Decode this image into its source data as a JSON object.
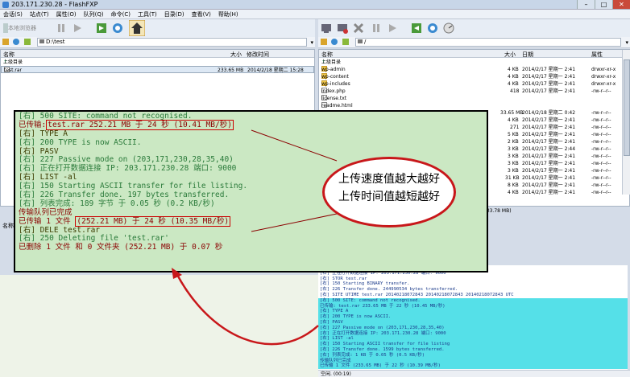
{
  "window": {
    "title": "203.171.230.28 - FlashFXP"
  },
  "menu": [
    "会话(S)",
    "站点(T)",
    "属性(O)",
    "队列(Q)",
    "命令(C)",
    "工具(T)",
    "目录(D)",
    "查看(V)",
    "帮助(H)"
  ],
  "left_toolbar": {
    "browser_label": "本地浏览器"
  },
  "left_path": "D:\\test",
  "right_path": "/",
  "left_pane": {
    "columns": {
      "name": "名称",
      "size": "大小",
      "modified": "修改时间"
    },
    "parent_label": "上级目录",
    "files": [
      {
        "name": "test.rar",
        "size": "233.65 MB",
        "date": "2014/2/18 星期二 15:28"
      }
    ]
  },
  "right_pane": {
    "columns": {
      "name": "名称",
      "size": "大小",
      "date": "日期",
      "attr": "属性"
    },
    "parent_label": "上级目录",
    "files": [
      {
        "name": "wp-admin",
        "size": "4 KB",
        "date": "2014/2/17 星期一 2:41",
        "attr": "drwxr-xr-x"
      },
      {
        "name": "wp-content",
        "size": "4 KB",
        "date": "2014/2/17 星期一 2:41",
        "attr": "drwxr-xr-x"
      },
      {
        "name": "wp-includes",
        "size": "4 KB",
        "date": "2014/2/17 星期一 2:41",
        "attr": "drwxr-xr-x"
      },
      {
        "name": "index.php",
        "size": "418",
        "date": "2014/2/17 星期一 2:41",
        "attr": "-rw-r--r--"
      },
      {
        "name": "license.txt",
        "size": "",
        "date": "",
        "attr": ""
      },
      {
        "name": "readme.html",
        "size": "",
        "date": "",
        "attr": ""
      }
    ],
    "extra_rows": [
      {
        "size": "33.65 MB",
        "date": "2014/2/18 星期二 0:42",
        "attr": "-rw-r--r--"
      },
      {
        "size": "4 KB",
        "date": "2014/2/17 星期一 2:41",
        "attr": "-rw-r--r--"
      },
      {
        "size": "271",
        "date": "2014/2/17 星期一 2:41",
        "attr": "-rw-r--r--"
      },
      {
        "size": "5 KB",
        "date": "2014/2/17 星期一 2:41",
        "attr": "-rw-r--r--"
      },
      {
        "size": "2 KB",
        "date": "2014/2/17 星期一 2:41",
        "attr": "-rw-r--r--"
      },
      {
        "size": "3 KB",
        "date": "2014/2/17 星期一 2:44",
        "attr": "-rw-r--r--"
      },
      {
        "size": "3 KB",
        "date": "2014/2/17 星期一 2:41",
        "attr": "-rw-r--r--"
      },
      {
        "size": "3 KB",
        "date": "2014/2/17 星期一 2:41",
        "attr": "-rw-r--r--"
      },
      {
        "size": "3 KB",
        "date": "2014/2/17 星期一 2:41",
        "attr": "-rw-r--r--"
      },
      {
        "size": "31 KB",
        "date": "2014/2/17 星期一 2:41",
        "attr": "-rw-r--r--"
      },
      {
        "size": "8 KB",
        "date": "2014/2/17 星期一 2:41",
        "attr": "-rw-r--r--"
      },
      {
        "size": "4 KB",
        "date": "2014/2/17 星期一 2:41",
        "attr": "-rw-r--r--"
      }
    ]
  },
  "right_speed": "233.78 MB)",
  "left_lower_header": "名称",
  "log_lines": [
    {
      "tag": "[右]",
      "text": " 500 SITE: command not recognised.",
      "cls": "g"
    },
    {
      "tag": "已传输:",
      "text": "test.rar 252.21 MB 于 24 秒 (10.41 MB/秒)",
      "cls": "r",
      "hl": true
    },
    {
      "tag": "[右]",
      "text": " TYPE A",
      "cls": "o"
    },
    {
      "tag": "[右]",
      "text": " 200 TYPE is now ASCII.",
      "cls": "g"
    },
    {
      "tag": "[右]",
      "text": " PASV",
      "cls": "o"
    },
    {
      "tag": "[右]",
      "text": " 227 Passive mode on (203,171,230,28,35,40)",
      "cls": "g"
    },
    {
      "tag": "[右]",
      "text": " 正在打开数据连接 IP: 203.171.230.28 端口: 9000",
      "cls": "g"
    },
    {
      "tag": "[右]",
      "text": " LIST -al",
      "cls": "o"
    },
    {
      "tag": "[右]",
      "text": " 150 Starting ASCII transfer for file listing.",
      "cls": "g"
    },
    {
      "tag": "[右]",
      "text": " 226 Transfer done. 197 bytes transferred.",
      "cls": "g"
    },
    {
      "tag": "[右]",
      "text": " 列表完成: 189 字节 于 0.05 秒 (0.2 KB/秒)",
      "cls": "g"
    },
    {
      "tag": "传输队列已完成",
      "text": "",
      "cls": "r"
    },
    {
      "tag": "已传输 1 文件 ",
      "text": "(252.21 MB) 于 24 秒 (10.35 MB/秒)",
      "cls": "r",
      "hl": true
    },
    {
      "tag": "[右]",
      "text": " DELE test.rar",
      "cls": "o"
    },
    {
      "tag": "[右]",
      "text": " 250 Deleting file 'test.rar'",
      "cls": "g"
    },
    {
      "tag": "已删除 1 文件 和 0 文件夹 (252.21 MB) 于 0.07 秒",
      "text": "",
      "cls": "r"
    }
  ],
  "callout": {
    "line1": "上传速度值越大越好",
    "line2": "上传时间值越短越好"
  },
  "right_log": [
    {
      "text": "[右] 227 Passive mode on (203,171,230,28,35,40)",
      "cyan": false
    },
    {
      "text": "[右] 正在打开数据连接 IP: 203.171.230.28 端口: 9000",
      "cyan": false
    },
    {
      "text": "[右] STOR test.rar",
      "cyan": false
    },
    {
      "text": "[右] 150 Starting BINARY transfer.",
      "cyan": false
    },
    {
      "text": "[右] 226 Transfer done. 244990534 bytes transferred.",
      "cyan": false
    },
    {
      "text": "[右] SITE UTIME test.rar 20140218072843 20140218072843 20140218072843 UTC",
      "cyan": false
    },
    {
      "text": "[右] 500 SITE: command not recognised.",
      "cyan": true
    },
    {
      "text": "已传输: test.rar 233.65 MB 于 22 秒 (10.45 MB/秒)",
      "cyan": true
    },
    {
      "text": "[右] TYPE A",
      "cyan": true
    },
    {
      "text": "[右] 200 TYPE is now ASCII.",
      "cyan": true
    },
    {
      "text": "[右] PASV",
      "cyan": true
    },
    {
      "text": "[右] 227 Passive mode on (203,171,230,28,35,40)",
      "cyan": true
    },
    {
      "text": "[右] 正在打开数据连接 IP: 203.171.230.28 端口: 9000",
      "cyan": true
    },
    {
      "text": "[右] LIST -al",
      "cyan": true
    },
    {
      "text": "[右] 150 Starting ASCII transfer for file listing",
      "cyan": true
    },
    {
      "text": "[右] 226 Transfer done. 1599 bytes transferred.",
      "cyan": true
    },
    {
      "text": "[右] 列表完成: 1 KB 于 0.05 秒 (0.5 KB/秒)",
      "cyan": true
    },
    {
      "text": "传输队列已完成",
      "cyan": true
    },
    {
      "text": "已传输 1 文件 (233.65 MB) 于 22 秒 (10.39 MB/秒)",
      "cyan": true
    }
  ],
  "status_bar": "空闲. (00:19)",
  "icons": [
    "connect-icon",
    "disconnect-icon",
    "abort-icon",
    "pause-icon",
    "play-icon",
    "transfer-icon",
    "refresh-icon",
    "home-icon"
  ],
  "colors": {
    "log_bg": "#cbe8c3",
    "callout_border": "#c8171a",
    "arrow": "#c8171a",
    "cyan_hl": "#55e0e8"
  }
}
